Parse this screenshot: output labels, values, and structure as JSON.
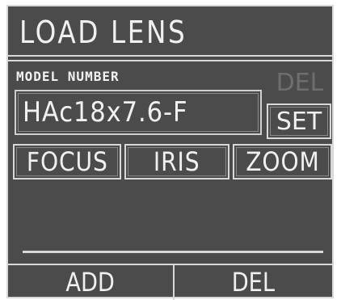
{
  "screen": {
    "title": "LOAD LENS",
    "model_label": "MODEL NUMBER",
    "model_value": "HAc18x7.6-F",
    "side_buttons": {
      "del_label": "DEL",
      "set_label": "SET"
    },
    "tabs": [
      {
        "label": "FOCUS"
      },
      {
        "label": "IRIS"
      },
      {
        "label": "ZOOM"
      }
    ],
    "bottom_buttons": {
      "add_label": "ADD",
      "del_label": "DEL"
    }
  },
  "colors": {
    "background": "#4b4b4b",
    "text": "#f0f0f0",
    "border": "#d8d8d8",
    "disabled_text": "#6e6e6e"
  }
}
